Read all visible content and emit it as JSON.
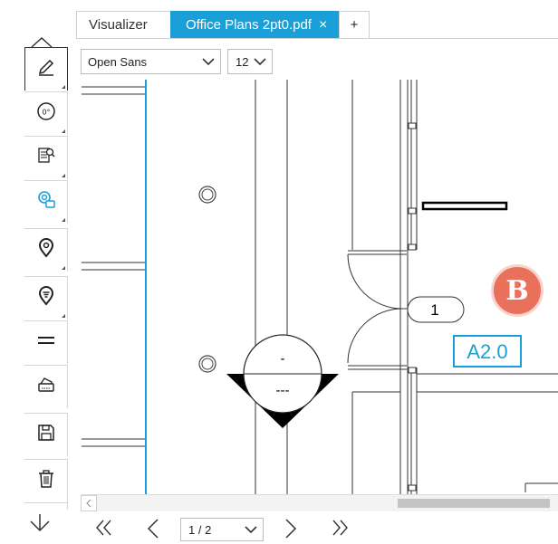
{
  "tabs": [
    {
      "label": "Visualizer",
      "active": false
    },
    {
      "label": "Office Plans 2pt0.pdf",
      "active": true,
      "close_icon": "×"
    }
  ],
  "new_tab_label": "+",
  "toolbar": {
    "tools": [
      {
        "name": "pencil-icon"
      },
      {
        "name": "dial-icon",
        "label": "0°"
      },
      {
        "name": "document-search-icon"
      },
      {
        "name": "location-search-icon",
        "active": true
      },
      {
        "name": "map-pin-icon"
      },
      {
        "name": "lamp-pin-icon"
      },
      {
        "name": "layers-icon"
      },
      {
        "name": "printer-icon"
      },
      {
        "name": "save-icon"
      },
      {
        "name": "trash-icon"
      }
    ]
  },
  "font_controls": {
    "font": "Open Sans",
    "size": "12"
  },
  "drawing": {
    "tag_1": "1",
    "door_symbol_top": "-",
    "door_symbol_bottom": "---",
    "label_a": "A2.0",
    "badge": "B"
  },
  "pager": {
    "page_label": "1 / 2"
  },
  "colors": {
    "accent": "#1a9fd8",
    "badge": "#e9705a"
  }
}
